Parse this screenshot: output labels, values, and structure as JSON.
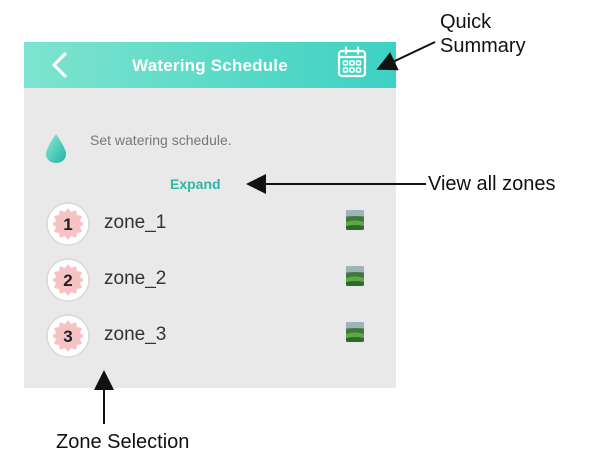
{
  "header": {
    "title": "Watering Schedule",
    "back_icon": "chevron-left-icon",
    "calendar_icon": "calendar-icon",
    "colors": {
      "start": "#7ee4cf",
      "end": "#3dd1c2"
    }
  },
  "hint": {
    "text": "Set watering schedule.",
    "icon": "water-drop-icon"
  },
  "expand_label": "Expand",
  "zones": [
    {
      "number": "1",
      "label": "zone_1"
    },
    {
      "number": "2",
      "label": "zone_2"
    },
    {
      "number": "3",
      "label": "zone_3"
    }
  ],
  "annotations": {
    "quick_summary_line1": "Quick",
    "quick_summary_line2": "Summary",
    "view_all_zones": "View all zones",
    "zone_selection": "Zone Selection"
  },
  "accent_color": "#2fb7a4"
}
